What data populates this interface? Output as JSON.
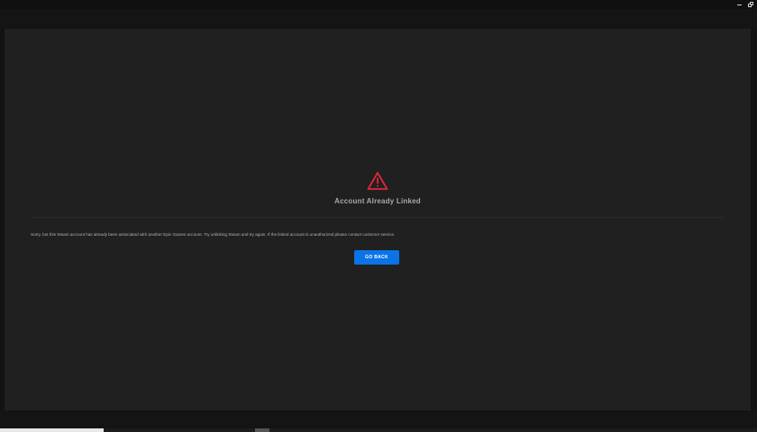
{
  "window": {
    "controls": {
      "minimize": "minimize",
      "restore": "restore"
    }
  },
  "dialog": {
    "icon": "warning-triangle-icon",
    "title": "Account Already Linked",
    "message": "Sorry, but this Steam account has already been associated with another Epic Games account. Try unlinking Steam and try again. If the linked account is unauthorized please contact customer service.",
    "go_back_label": "GO BACK"
  },
  "colors": {
    "accent_button": "#0a74e6",
    "warning": "#e0283c",
    "panel_background": "#202020",
    "window_background": "#121212"
  }
}
